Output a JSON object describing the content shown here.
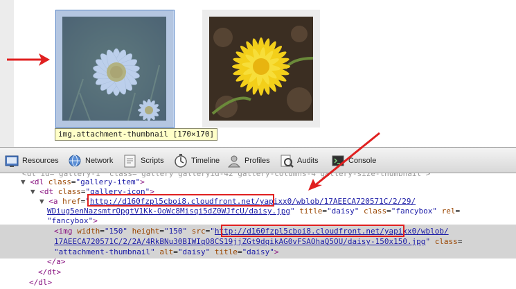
{
  "page": {
    "gallery": [
      {
        "alt": "daisy"
      },
      {
        "alt": "dandelion"
      }
    ],
    "tooltip": "img.attachment-thumbnail [170×170]"
  },
  "devtools": {
    "toolbar": [
      {
        "label": "Resources",
        "icon": "resources-icon"
      },
      {
        "label": "Network",
        "icon": "network-icon"
      },
      {
        "label": "Scripts",
        "icon": "scripts-icon"
      },
      {
        "label": "Timeline",
        "icon": "timeline-icon"
      },
      {
        "label": "Profiles",
        "icon": "profiles-icon"
      },
      {
        "label": "Audits",
        "icon": "audits-icon"
      },
      {
        "label": "Console",
        "icon": "console-icon"
      }
    ],
    "elements": {
      "l0_partial": "<ul id=\"gallery-1\" class=\"gallery galleryid-42 gallery-columns-4 gallery-size-thumbnail\">",
      "dl_tag": "dl",
      "dl_class_attr": "class",
      "dl_class_val": "\"gallery-item\"",
      "dt_tag": "dt",
      "dt_class_attr": "class",
      "dt_class_val": "\"gallery-icon\"",
      "a_tag": "a",
      "a_href_attr": "href",
      "a_href_part1": "http://d160fzpl5cboi8.cloudfront.net/",
      "a_href_part2": "yapixx0/wblob/17AEECA720571C/2/29/",
      "a_href_part3": "WDiug5enNazsmtrOpgtV1Kk-OoWc8Misqi5dZ0WJfcU/daisy.jpg",
      "a_title_attr": "title",
      "a_title_val": "\"daisy\"",
      "a_class_attr": "class",
      "a_class_val": "\"fancybox\"",
      "a_rel_attr": "rel",
      "a_rel_val": "\"fancybox\"",
      "img_tag": "img",
      "img_width_attr": "width",
      "img_width_val": "\"150\"",
      "img_height_attr": "height",
      "img_height_val": "\"150\"",
      "img_src_attr": "src",
      "img_src_part1": "http://d160fzpl5cboi8.cloudfront.net/",
      "img_src_part2": "yapixx0/wblob/",
      "img_src_part3": "17AEECA720571C/2/2A/4RkBNu30BIWIqO8CS19jjZGt9dqikAG0vFSAOhaQ5OU/daisy-150x150.jpg",
      "img_class_attr": "class",
      "img_class_val": "\"attachment-thumbnail\"",
      "img_alt_attr": "alt",
      "img_alt_val": "\"daisy\"",
      "img_title_attr": "title",
      "img_title_val": "\"daisy\"",
      "close_a": "</a>",
      "close_dt": "</dt>",
      "close_dl": "</dl>"
    }
  },
  "colors": {
    "annotation": "#e02020",
    "tag": "#881280",
    "attr_name": "#994500",
    "attr_value": "#1a1aa6",
    "selection": "#d4d4d4",
    "tooltip_bg": "#ffffc8"
  }
}
